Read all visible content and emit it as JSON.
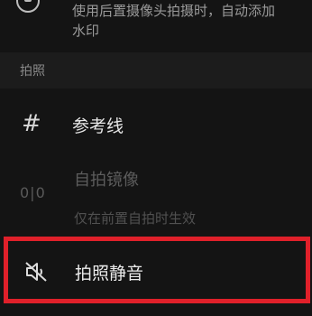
{
  "watermark_row": {
    "description": "使用后置摄像头拍摄时，自动添加\n水印"
  },
  "section": {
    "label": "拍照"
  },
  "items": [
    {
      "title": "参考线",
      "icon": "grid-icon"
    },
    {
      "title": "自拍镜像",
      "subtitle": "仅在前置自拍时生效",
      "icon": "mirror-icon",
      "enabled": false
    },
    {
      "title": "拍照静音",
      "icon": "mute-icon",
      "highlighted": true
    }
  ],
  "colors": {
    "background": "#141414",
    "highlight_border": "#e0202a"
  }
}
